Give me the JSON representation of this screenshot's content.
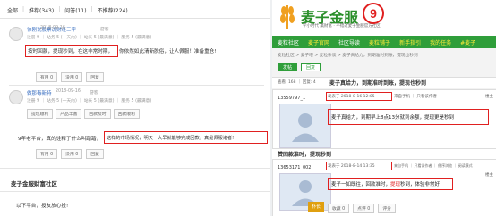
{
  "left": {
    "tabs": [
      "全部",
      "推荐(343)",
      "问答(11)",
      "不推荐(224)"
    ],
    "post1": {
      "username": "徐刚说股票说财经三字",
      "meta_tag": "游客",
      "meta_line": "注册 9 ｜ 站务 5 (一天內) ｜ 站长 5 (最满意) ｜ 服务 5 (最满意)",
      "time": "2018-09-16",
      "text_boxed": "按时回款，提现秒到，在这非常时期，",
      "text_rest": "你依然如此清新脱俗，让人佩服！准备重仓!",
      "buttons": [
        "有用 0",
        "没用 0",
        "回复"
      ]
    },
    "post2": {
      "username": "做那毒新特",
      "meta_tag": "游客",
      "meta_line": "注册 9 ｜ 站务 5 (一天內) ｜ 站长 5 (最满意) ｜ 服务 5 (最满意)",
      "time": "2018-09-16",
      "buttons_row": [
        "提现顺利",
        "产品丰富",
        "回款及时",
        "回款顺利"
      ],
      "text_start": "9年老平台，真的诠释了什么叫踏踏，",
      "text_boxed": "这样的市场情况，明天一大早就能够完成回款，真是佩服诸者!",
      "buttons": [
        "有用 0",
        "没用 0",
        "回复"
      ]
    },
    "community_title": "麦子金服财富社区",
    "bottom_line": "以下平台，投友放心投!"
  },
  "right": {
    "logo_text": "麦子金服",
    "slogan": "学小时代 赢财富 · 不错过麦子金服官方社区",
    "badge_number": "9",
    "nav": [
      "麦粒社区",
      "麦子官网",
      "社区导读",
      "麦粒铺子",
      "新手指引",
      "我的任务",
      "#麦子"
    ],
    "breadcrumb": "麦粒社区 > 麦子吧 > 麦粒杂谈 > 麦子真给力，到期准时到账，提现也秒到",
    "post_button": "发帖",
    "reply_button": "回复",
    "views": "查看: 168 ｜ 回复: 4",
    "thread_title": "麦子真给力，到期准时到账，提现也秒到",
    "post1": {
      "user": "13559797_1",
      "badge": "发表于 2018-8-16 12:05",
      "meta": "来自手机 ｜ 只看该作者 ｜",
      "floor": "楼主",
      "text": "麦子真给力，到期早上8点13分就到余额，提现更是秒到"
    },
    "thread_title2": "赞回款准时，提现秒到",
    "post2": {
      "user": "13653171_002",
      "badge": "发表于 2018-8-14 13:35",
      "meta": "来自手机 ｜ 只看该作者 ｜ 倒序浏览 ｜ 阅读模式",
      "floor": "楼主",
      "text_pre": "麦子一如既往，回款准时，",
      "text_red": "提现",
      "text_post": "秒到，体验非常好"
    },
    "footer_buttons": [
      "收藏 0",
      "点评 0",
      "评分"
    ],
    "avatar_label": "朴长"
  },
  "colors": {
    "green": "#2f9e3a",
    "red": "#e02020",
    "link": "#3a6fc1"
  }
}
